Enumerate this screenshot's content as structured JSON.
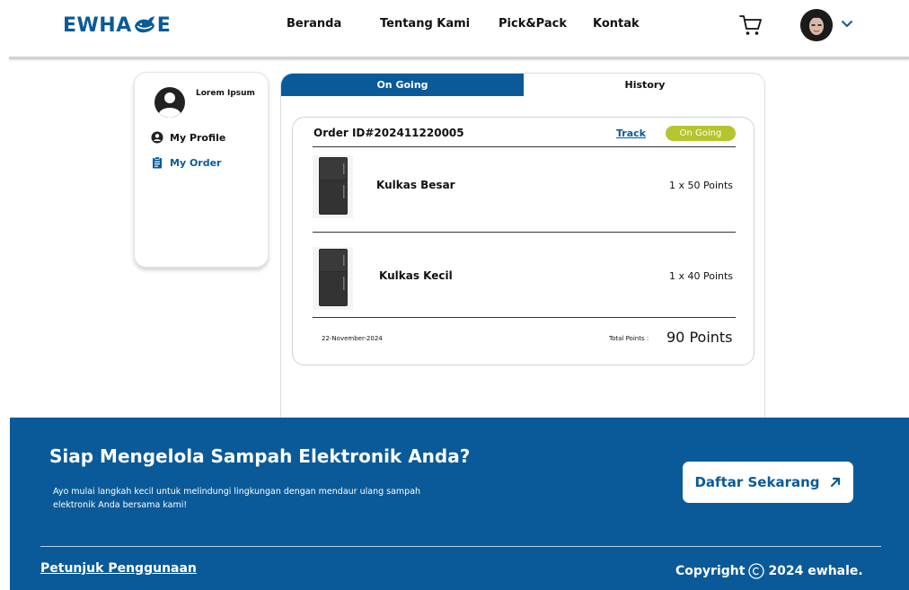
{
  "header": {
    "logo": {
      "part1": "EWHA",
      "part2": "E",
      "icon": "whale-icon"
    },
    "nav": [
      "Beranda",
      "Tentang Kami",
      "Pick&Pack",
      "Kontak"
    ],
    "icons": {
      "cart": "cart-icon",
      "avatar": "avatar-photo",
      "dropdown": "chevron-down-icon"
    }
  },
  "sidebar": {
    "user_name": "Lorem Ipsum",
    "items": [
      {
        "label": "My Profile",
        "icon": "user-circle-icon",
        "active": false
      },
      {
        "label": "My Order",
        "icon": "clipboard-icon",
        "active": true
      }
    ]
  },
  "tabs": [
    {
      "label": "On Going",
      "active": true
    },
    {
      "label": "History",
      "active": false
    }
  ],
  "order": {
    "id_label": "Order ID#202411220005",
    "track_label": "Track",
    "status": "On Going",
    "items": [
      {
        "name": "Kulkas Besar",
        "qty": "1 x 50 Points",
        "image": "refrigerator-image"
      },
      {
        "name": "Kulkas Kecil",
        "qty": "1 x 40 Points",
        "image": "refrigerator-image"
      }
    ],
    "date": "22-November-2024",
    "total_label": "Total Points :",
    "total_value": "90 Points"
  },
  "footer": {
    "cta_title": "Siap Mengelola Sampah Elektronik Anda?",
    "cta_desc": "Ayo mulai langkah kecil untuk melindungi lingkungan dengan mendaur ulang sampah elektronik Anda bersama kami!",
    "cta_button": "Daftar Sekarang",
    "guide_link": "Petunjuk Penggunaan",
    "copyright_prefix": "Copyright",
    "copyright_suffix": "2024 ewhale."
  },
  "colors": {
    "brand": "#0a5a99",
    "status_pill": "#b5c42f",
    "white": "#ffffff"
  }
}
